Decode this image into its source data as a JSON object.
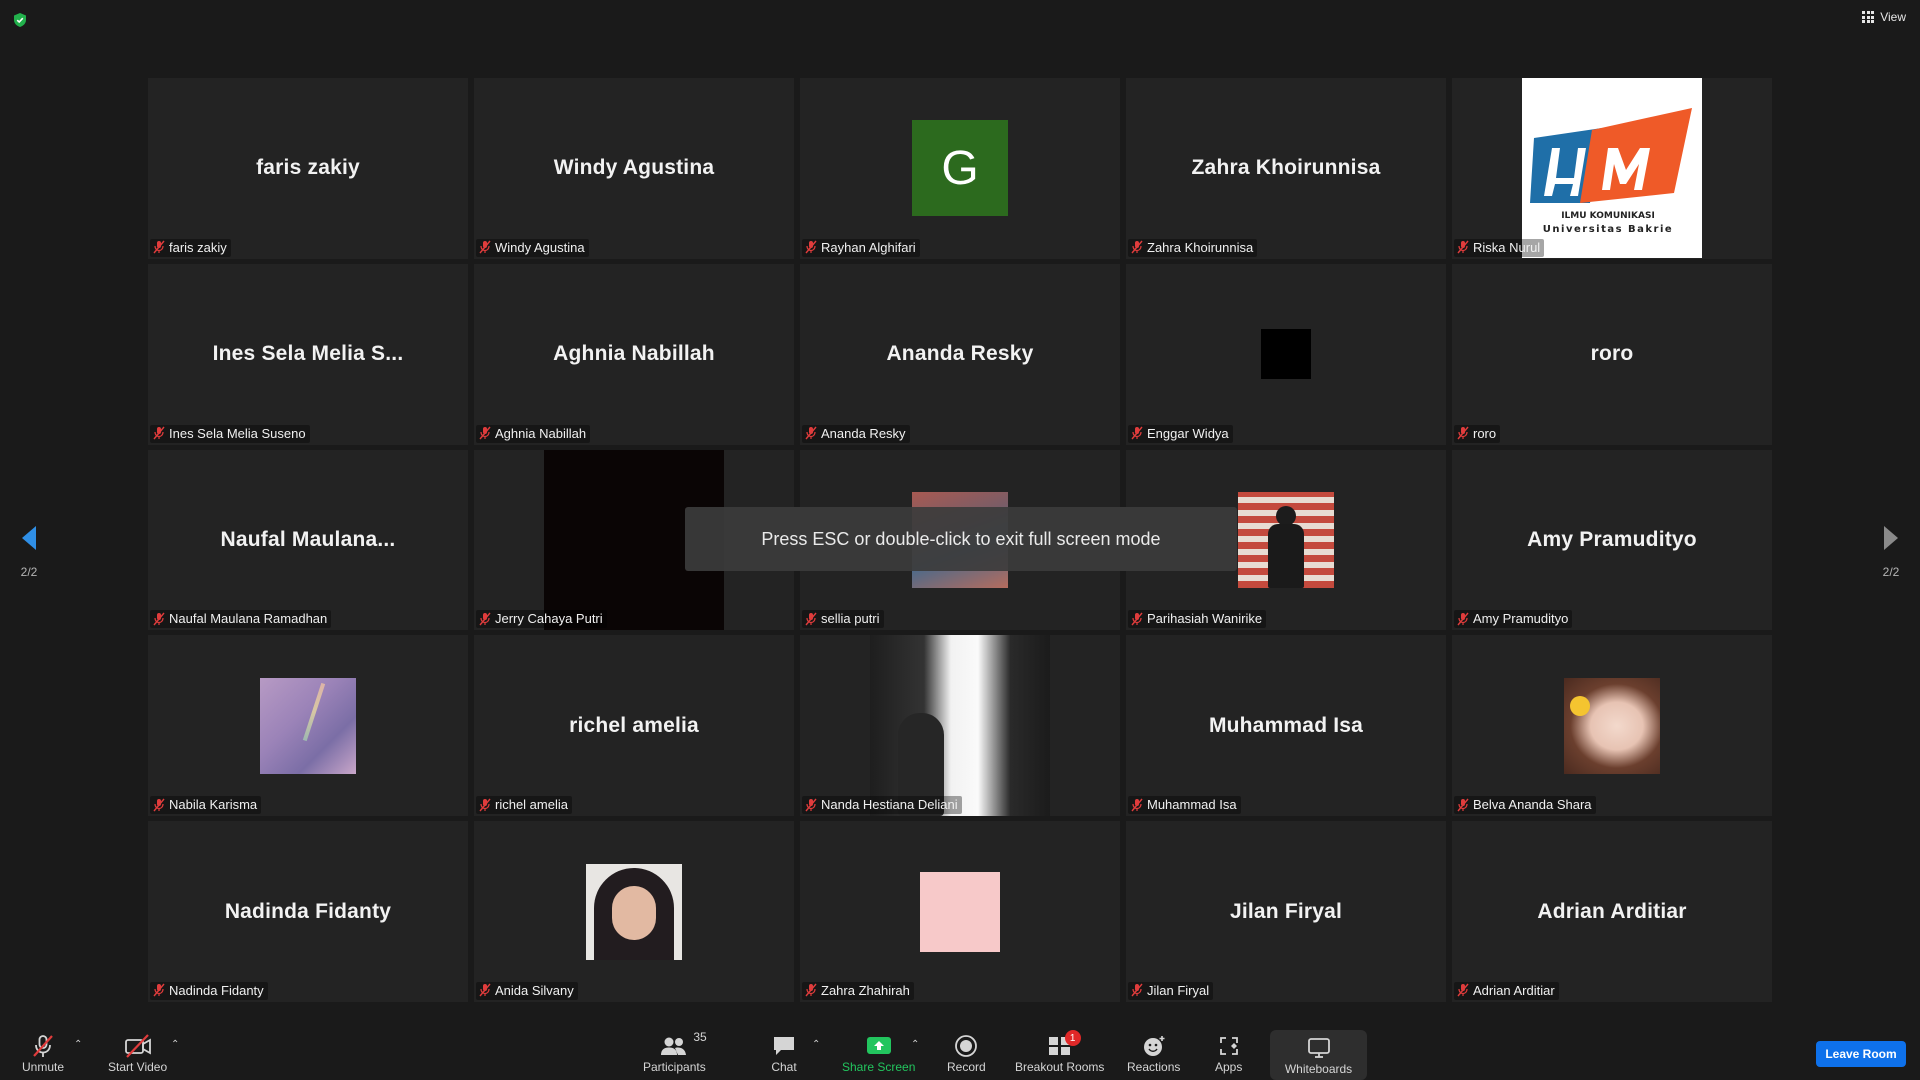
{
  "top": {
    "view_label": "View"
  },
  "nav": {
    "left_page": "2/2",
    "right_page": "2/2"
  },
  "toast": {
    "text": "Press ESC or double-click to exit full screen mode"
  },
  "tiles": [
    {
      "label": "faris zakiy",
      "big": "faris zakiy"
    },
    {
      "label": "Windy Agustina",
      "big": "Windy Agustina"
    },
    {
      "label": "Rayhan Alghifari",
      "letter": "G"
    },
    {
      "label": "Zahra Khoirunnisa",
      "big": "Zahra Khoirunnisa"
    },
    {
      "label": "Riska Nurul",
      "logo_top": "ILMU KOMUNIKASI",
      "logo_bottom": "Universitas Bakrie"
    },
    {
      "label": "Ines Sela Melia Suseno",
      "big": "Ines Sela Melia S..."
    },
    {
      "label": "Aghnia Nabillah",
      "big": "Aghnia Nabillah"
    },
    {
      "label": "Ananda Resky",
      "big": "Ananda Resky"
    },
    {
      "label": "Enggar Widya"
    },
    {
      "label": "roro",
      "big": "roro"
    },
    {
      "label": "Naufal Maulana Ramadhan",
      "big": "Naufal  Maulana..."
    },
    {
      "label": "Jerry Cahaya Putri"
    },
    {
      "label": "sellia putri"
    },
    {
      "label": "Parihasiah Wanirike"
    },
    {
      "label": "Amy Pramudityo",
      "big": "Amy Pramudityo"
    },
    {
      "label": "Nabila Karisma"
    },
    {
      "label": "richel amelia",
      "big": "richel amelia"
    },
    {
      "label": "Nanda Hestiana Deliani"
    },
    {
      "label": "Muhammad Isa",
      "big": "Muhammad Isa"
    },
    {
      "label": "Belva Ananda Shara"
    },
    {
      "label": "Nadinda Fidanty",
      "big": "Nadinda Fidanty"
    },
    {
      "label": "Anida Silvany"
    },
    {
      "label": "Zahra Zhahirah"
    },
    {
      "label": "Jilan Firyal",
      "big": "Jilan Firyal"
    },
    {
      "label": "Adrian Arditiar",
      "big": "Adrian Arditiar"
    }
  ],
  "toolbar": {
    "unmute": "Unmute",
    "start_video": "Start Video",
    "participants": "Participants",
    "participants_count": "35",
    "chat": "Chat",
    "share_screen": "Share Screen",
    "record": "Record",
    "breakout_rooms": "Breakout Rooms",
    "breakout_badge": "1",
    "reactions": "Reactions",
    "apps": "Apps",
    "whiteboards": "Whiteboards",
    "leave_room": "Leave Room"
  },
  "colors": {
    "share_green": "#22c55e",
    "leave_blue": "#0e71eb",
    "badge_red": "#e02828",
    "nav_blue": "#2f8fe6"
  }
}
